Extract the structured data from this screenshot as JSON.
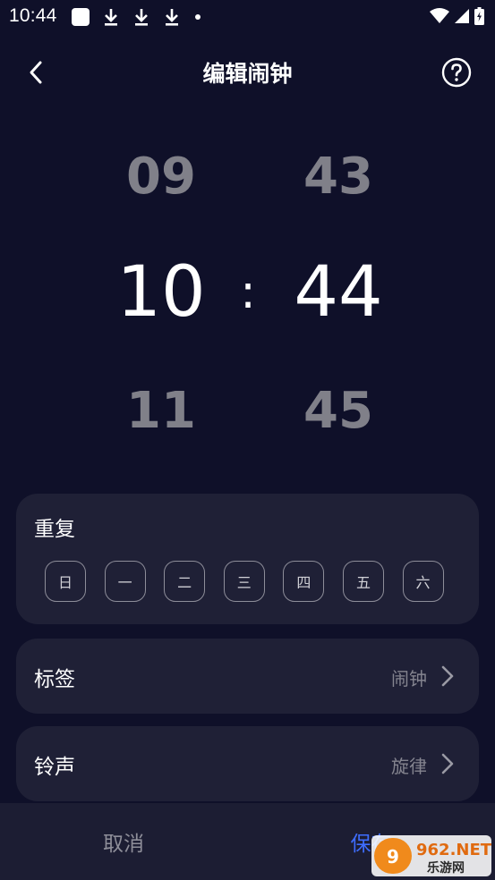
{
  "status_bar": {
    "time": "10:44"
  },
  "header": {
    "title": "编辑闹钟"
  },
  "picker": {
    "hours": {
      "prev": "09",
      "selected": "10",
      "next": "11"
    },
    "separator": ":",
    "minutes": {
      "prev": "43",
      "selected": "44",
      "next": "45"
    }
  },
  "repeat": {
    "title": "重复",
    "days": [
      "日",
      "一",
      "二",
      "三",
      "四",
      "五",
      "六"
    ]
  },
  "label_row": {
    "title": "标签",
    "value": "闹钟"
  },
  "ringtone_row": {
    "title": "铃声",
    "value": "旋律"
  },
  "bottom": {
    "cancel": "取消",
    "save": "保存"
  },
  "watermark": {
    "line1": "962.NET",
    "line2": "乐游网"
  },
  "colors": {
    "background": "#0f1029",
    "card": "#1f2036",
    "accent": "#3e6dff"
  }
}
